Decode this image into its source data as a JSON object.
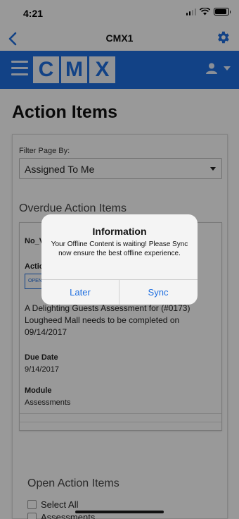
{
  "status_bar": {
    "time": "4:21",
    "battery_level": 0.9
  },
  "nav": {
    "title": "CMX1"
  },
  "header": {
    "logo_letters": [
      "C",
      "M",
      "X"
    ],
    "accent_color": "#1f6fe0"
  },
  "page": {
    "title": "Action Items"
  },
  "filter": {
    "label": "Filter Page By:",
    "selected": "Assigned To Me"
  },
  "overdue": {
    "title": "Overdue Action Items",
    "card": {
      "id": "No_V",
      "actions_label": "Actio",
      "open_button": "OPEN",
      "description": "A Delighting Guests Assessment for (#0173) Lougheed Mall needs to be completed on 09/14/2017",
      "due_date_label": "Due Date",
      "due_date": "9/14/2017",
      "module_label": "Module",
      "module": "Assessments"
    }
  },
  "open_items": {
    "title": "Open Action Items",
    "checkboxes": [
      {
        "label": "Select All"
      },
      {
        "label": "Assessments"
      }
    ]
  },
  "alert": {
    "title": "Information",
    "message": "Your Offline Content is waiting! Please Sync now ensure the best offline experience.",
    "buttons": {
      "later": "Later",
      "sync": "Sync"
    }
  }
}
